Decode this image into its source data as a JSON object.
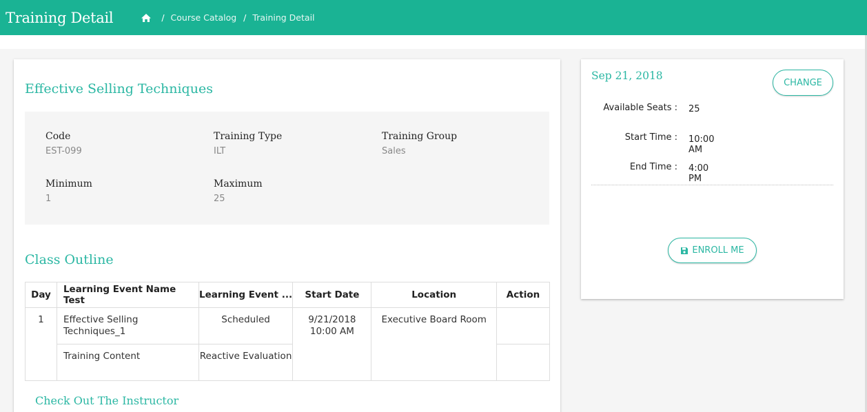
{
  "header": {
    "title": "Training Detail",
    "breadcrumb": [
      "Course Catalog",
      "Training Detail"
    ]
  },
  "course": {
    "title": "Effective Selling Techniques",
    "fields": {
      "code": {
        "label": "Code",
        "value": "EST-099"
      },
      "training_type": {
        "label": "Training Type",
        "value": "ILT"
      },
      "training_group": {
        "label": "Training Group",
        "value": "Sales"
      },
      "minimum": {
        "label": "Minimum",
        "value": "1"
      },
      "maximum": {
        "label": "Maximum",
        "value": "25"
      }
    }
  },
  "outline": {
    "title": "Class Outline",
    "columns": [
      "Day",
      "Learning Event Name Test",
      "Learning Event ...",
      "Start Date",
      "Location",
      "Action"
    ],
    "rows": [
      {
        "day": "1",
        "name": "Effective Selling Techniques_1",
        "type": "Scheduled",
        "date": "9/21/2018",
        "time": "10:00 AM",
        "location": "Executive Board Room",
        "action": ""
      },
      {
        "name": "Training Content",
        "type": "Reactive Evaluation",
        "action": ""
      }
    ]
  },
  "instructor_link": "Check Out The Instructor",
  "session": {
    "date": "Sep 21, 2018",
    "change_label": "CHANGE",
    "available_seats": {
      "label": "Available Seats :",
      "value": "25"
    },
    "start_time": {
      "label": "Start Time :",
      "value": "10:00 AM"
    },
    "end_time": {
      "label": "End Time :",
      "value": "4:00 PM"
    },
    "enroll_label": "ENROLL ME"
  },
  "icons": {
    "home": "home-icon",
    "save": "save-icon"
  },
  "colors": {
    "header_bg": "#1ab394",
    "accent": "#2bb7a3"
  }
}
